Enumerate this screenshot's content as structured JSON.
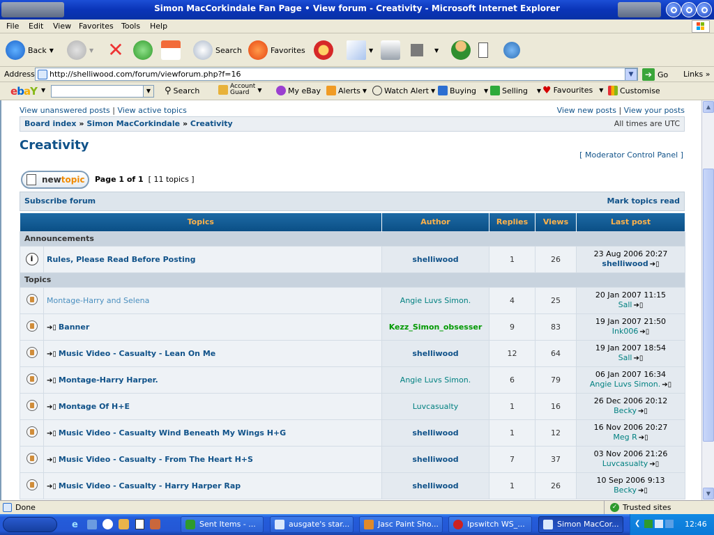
{
  "window": {
    "title": "Simon MacCorkindale Fan Page • View forum - Creativity - Microsoft Internet Explorer"
  },
  "menu": [
    "File",
    "Edit",
    "View",
    "Favorites",
    "Tools",
    "Help"
  ],
  "toolbar": {
    "back": "Back",
    "search": "Search",
    "favorites": "Favorites"
  },
  "address": {
    "label": "Address",
    "url": "http://shelliwood.com/forum/viewforum.php?f=16",
    "go": "Go",
    "links": "Links"
  },
  "ebay": {
    "search": "Search",
    "account_guard_1": "Account",
    "account_guard_2": "Guard",
    "my_ebay": "My eBay",
    "alerts": "Alerts",
    "watch_alert": "Watch Alert",
    "buying": "Buying",
    "selling": "Selling",
    "favourites": "Favourites",
    "customise": "Customise"
  },
  "page": {
    "nav": {
      "unanswered": "View unanswered posts",
      "active": "View active topics",
      "new_posts": "View new posts",
      "your_posts": "View your posts",
      "sep": "|"
    },
    "breadcrumbs": {
      "index": "Board index",
      "parent": "Simon MacCorkindale",
      "current": "Creativity",
      "sep": "»",
      "times": "All times are UTC"
    },
    "title": "Creativity",
    "modcp": "Moderator Control Panel",
    "newtopic": {
      "a": "new",
      "b": "topic"
    },
    "pagination": {
      "page": "Page 1 of 1",
      "count": "[ 11 topics ]"
    },
    "subscribe": "Subscribe forum",
    "mark_read": "Mark topics read",
    "columns": {
      "topics": "Topics",
      "author": "Author",
      "replies": "Replies",
      "views": "Views",
      "last_post": "Last post"
    },
    "sections": {
      "announcements": "Announcements",
      "topics": "Topics"
    },
    "announcement": {
      "title": "Rules, Please Read Before Posting",
      "author": "shelliwood",
      "replies": "1",
      "views": "26",
      "last_date": "23 Aug 2006 20:27",
      "last_user": "shelliwood"
    },
    "topics": [
      {
        "title": "Montage-Harry and Selena",
        "author": "Angie Luvs Simon.",
        "replies": "4",
        "views": "25",
        "last_date": "20 Jan 2007 11:15",
        "last_user": "Sall",
        "arrow": false
      },
      {
        "title": "Banner",
        "author": "Kezz_Simon_obsesser",
        "replies": "9",
        "views": "83",
        "last_date": "19 Jan 2007 21:50",
        "last_user": "Ink006",
        "arrow": true
      },
      {
        "title": "Music Video - Casualty - Lean On Me",
        "author": "shelliwood",
        "replies": "12",
        "views": "64",
        "last_date": "19 Jan 2007 18:54",
        "last_user": "Sall",
        "arrow": true
      },
      {
        "title": "Montage-Harry Harper.",
        "author": "Angie Luvs Simon.",
        "replies": "6",
        "views": "79",
        "last_date": "06 Jan 2007 16:34",
        "last_user": "Angie Luvs Simon.",
        "arrow": true
      },
      {
        "title": "Montage Of H+E",
        "author": "Luvcasualty",
        "replies": "1",
        "views": "16",
        "last_date": "26 Dec 2006 20:12",
        "last_user": "Becky",
        "arrow": true
      },
      {
        "title": "Music Video - Casualty Wind Beneath My Wings H+G",
        "author": "shelliwood",
        "replies": "1",
        "views": "12",
        "last_date": "16 Nov 2006 20:27",
        "last_user": "Meg R",
        "arrow": true
      },
      {
        "title": "Music Video - Casualty - From The Heart H+S",
        "author": "shelliwood",
        "replies": "7",
        "views": "37",
        "last_date": "03 Nov 2006 21:26",
        "last_user": "Luvcasualty",
        "arrow": true
      },
      {
        "title": "Music Video - Casualty - Harry Harper Rap",
        "author": "shelliwood",
        "replies": "1",
        "views": "26",
        "last_date": "10 Sep 2006 9:13",
        "last_user": "Becky",
        "arrow": true
      }
    ]
  },
  "status": {
    "text": "Done",
    "zone": "Trusted sites"
  },
  "taskbar": {
    "tasks": [
      "Sent Items - ...",
      "ausgate's star...",
      "Jasc Paint Sho...",
      "Ipswitch WS_...",
      "Simon MacCor..."
    ],
    "clock": "12:46"
  },
  "colors": {
    "link": "#105289",
    "header_text": "#ffb24a",
    "kezz": "#009900",
    "angie": "#008080"
  }
}
